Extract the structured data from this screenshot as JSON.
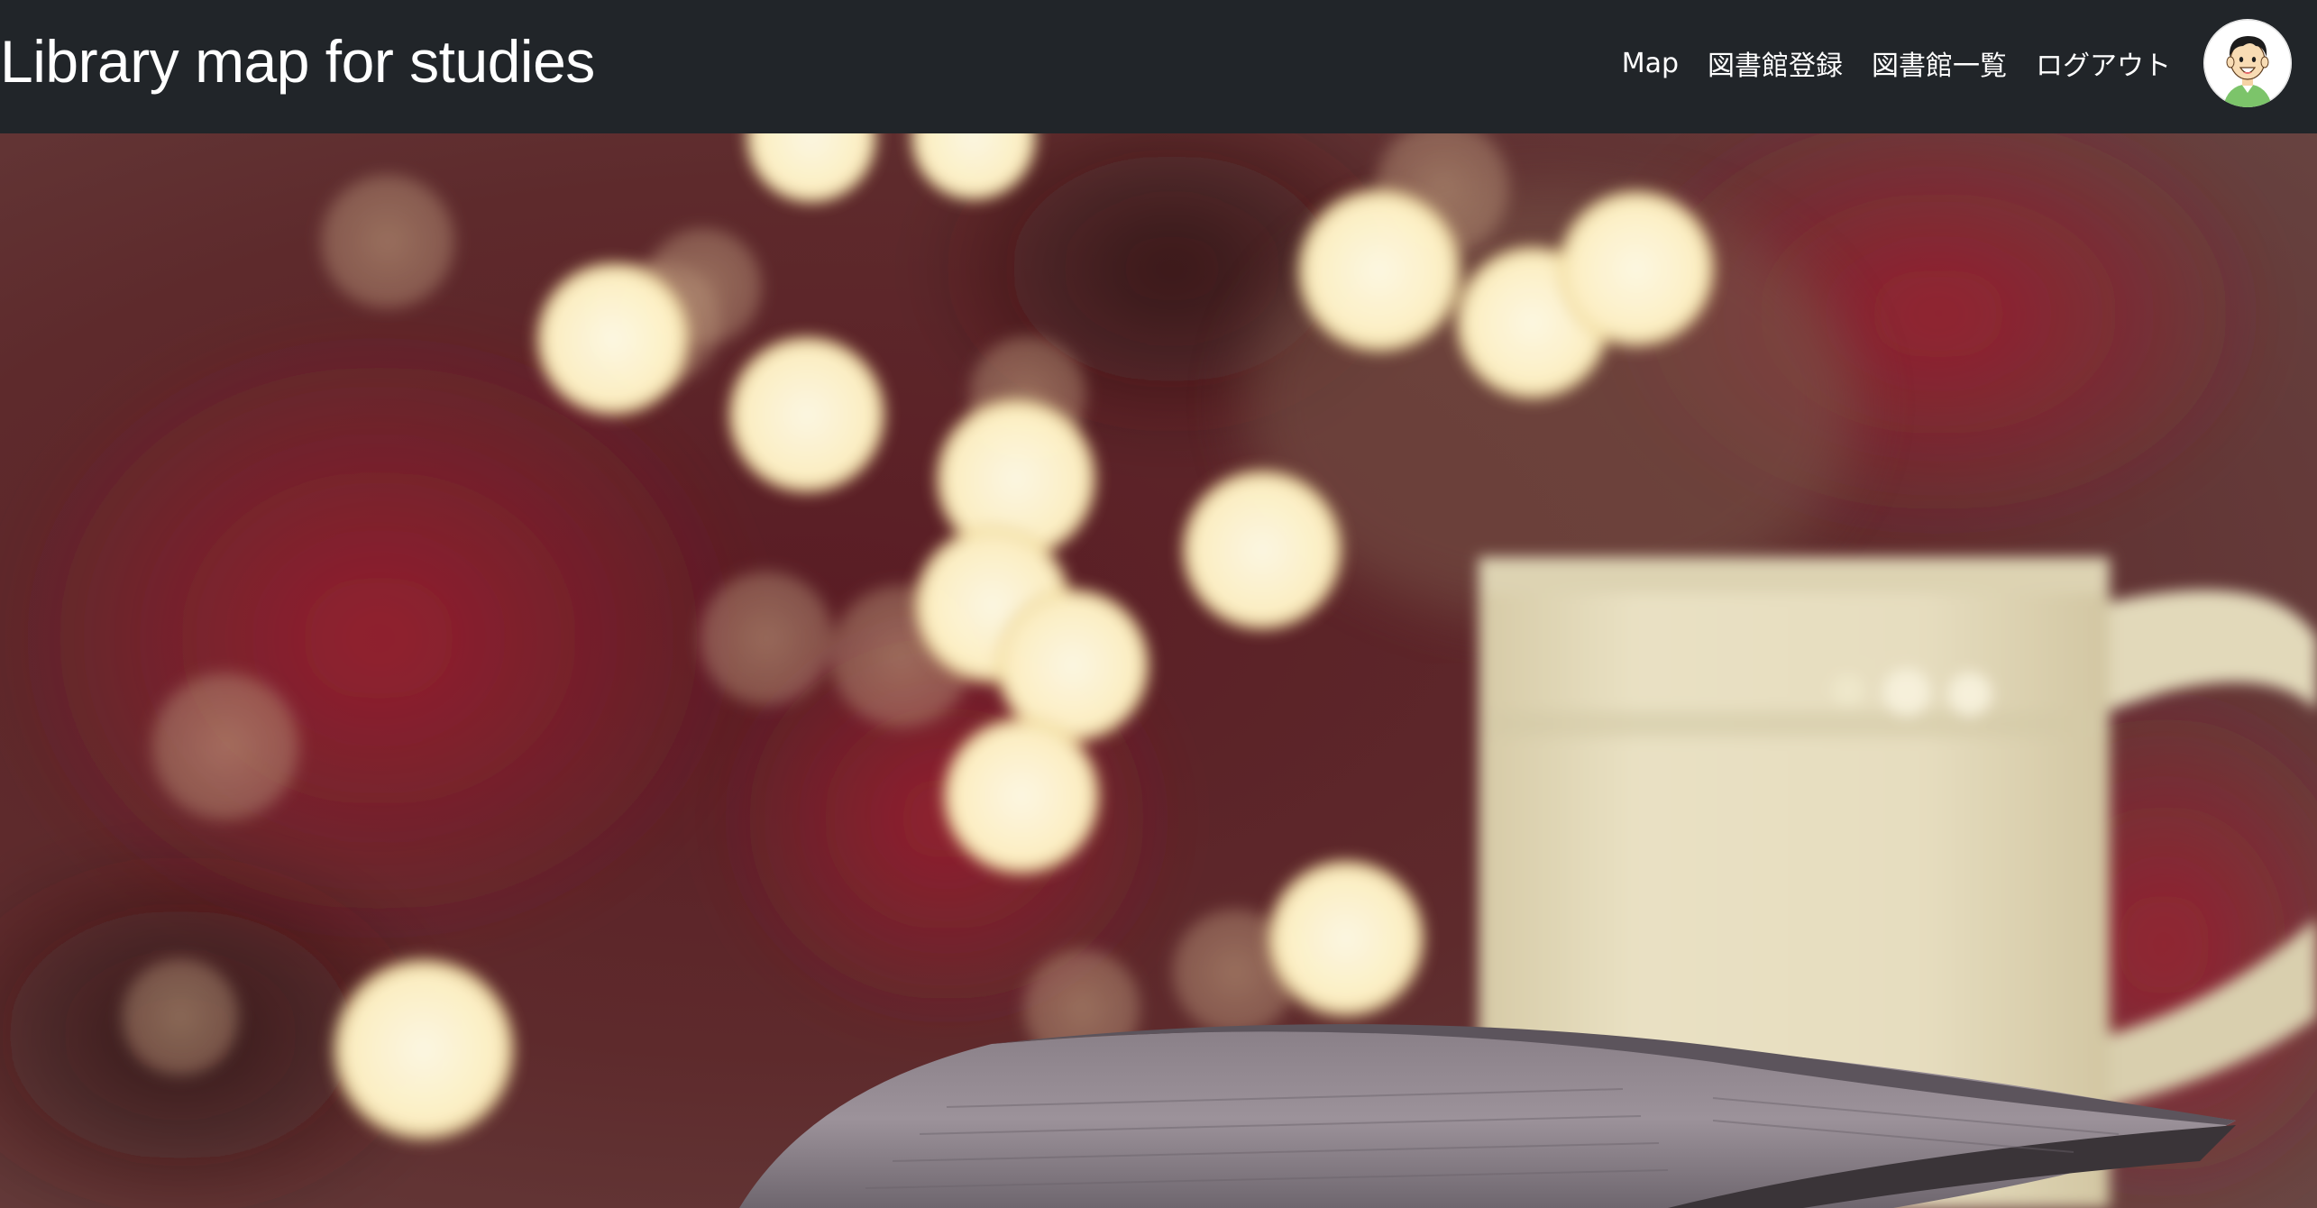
{
  "navbar": {
    "brand": "Library map for studies",
    "links": [
      {
        "label": "Map"
      },
      {
        "label": "図書館登録"
      },
      {
        "label": "図書館一覧"
      },
      {
        "label": "ログアウト"
      }
    ],
    "avatar_icon": "user-avatar-icon",
    "background_color": "#212529",
    "text_color": "#ffffff"
  },
  "hero": {
    "image_icon": "bokeh-coffee-book-photo",
    "colors": {
      "bokeh": "#fff6d0",
      "mug": "#e7dfc0",
      "background_red": "#7a1c2a"
    }
  }
}
